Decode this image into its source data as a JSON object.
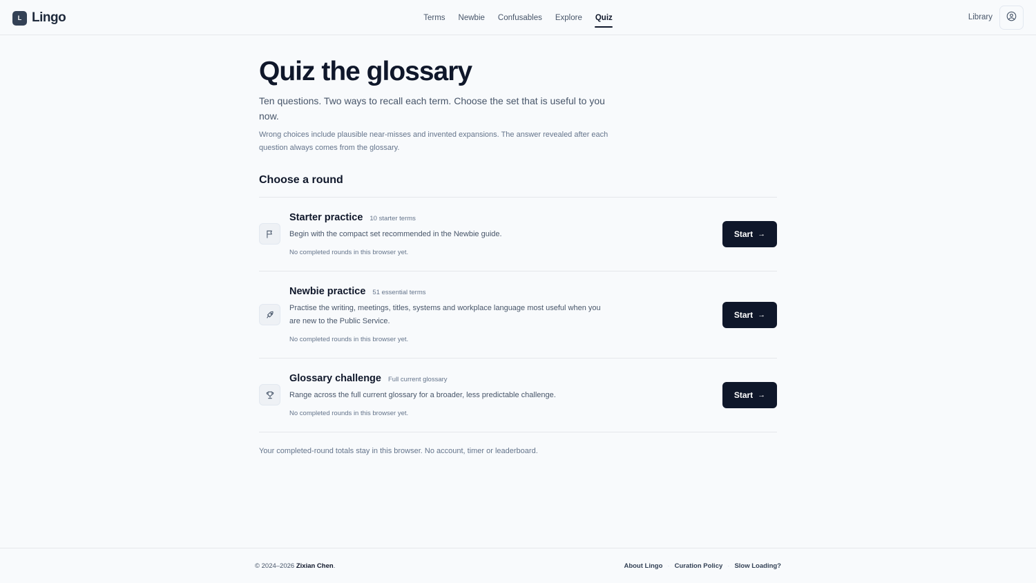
{
  "brand": {
    "mark": "L",
    "name": "Lingo"
  },
  "nav": {
    "items": [
      {
        "label": "Terms"
      },
      {
        "label": "Newbie"
      },
      {
        "label": "Confusables"
      },
      {
        "label": "Explore"
      },
      {
        "label": "Quiz",
        "active": true
      }
    ],
    "library_label": "Library",
    "account_icon": "user-circle-icon"
  },
  "page": {
    "title": "Quiz the glossary",
    "lede": "Ten questions. Two ways to recall each term. Choose the set that is useful to you now.",
    "fineprint": "Wrong choices include plausible near-misses and invented expansions. The answer revealed after each question always comes from the glossary.",
    "section_title": "Choose a round",
    "storage_note": "Your completed-round totals stay in this browser. No account, timer or leaderboard."
  },
  "rounds": [
    {
      "icon": "flag-icon",
      "name": "Starter practice",
      "count": "10 starter terms",
      "description": "Begin with the compact set recommended in the Newbie guide.",
      "status": "No completed rounds in this browser yet.",
      "button_label": "Start"
    },
    {
      "icon": "rocket-icon",
      "name": "Newbie practice",
      "count": "51 essential terms",
      "description": "Practise the writing, meetings, titles, systems and workplace language most useful when you are new to the Public Service.",
      "status": "No completed rounds in this browser yet.",
      "button_label": "Start"
    },
    {
      "icon": "trophy-icon",
      "name": "Glossary challenge",
      "count": "Full current glossary",
      "description": "Range across the full current glossary for a broader, less predictable challenge.",
      "status": "No completed rounds in this browser yet.",
      "button_label": "Start"
    }
  ],
  "footer": {
    "copyright_prefix": "© 2024–2026",
    "author": "Zixian Chen",
    "copyright_suffix": ".",
    "links": [
      {
        "label": "About Lingo"
      },
      {
        "label": "Curation Policy"
      },
      {
        "label": "Slow Loading?"
      }
    ]
  },
  "colors": {
    "background": "#f8fafc",
    "primary": "#0f172a",
    "muted_text": "#64748b",
    "border": "#e5e7eb"
  }
}
